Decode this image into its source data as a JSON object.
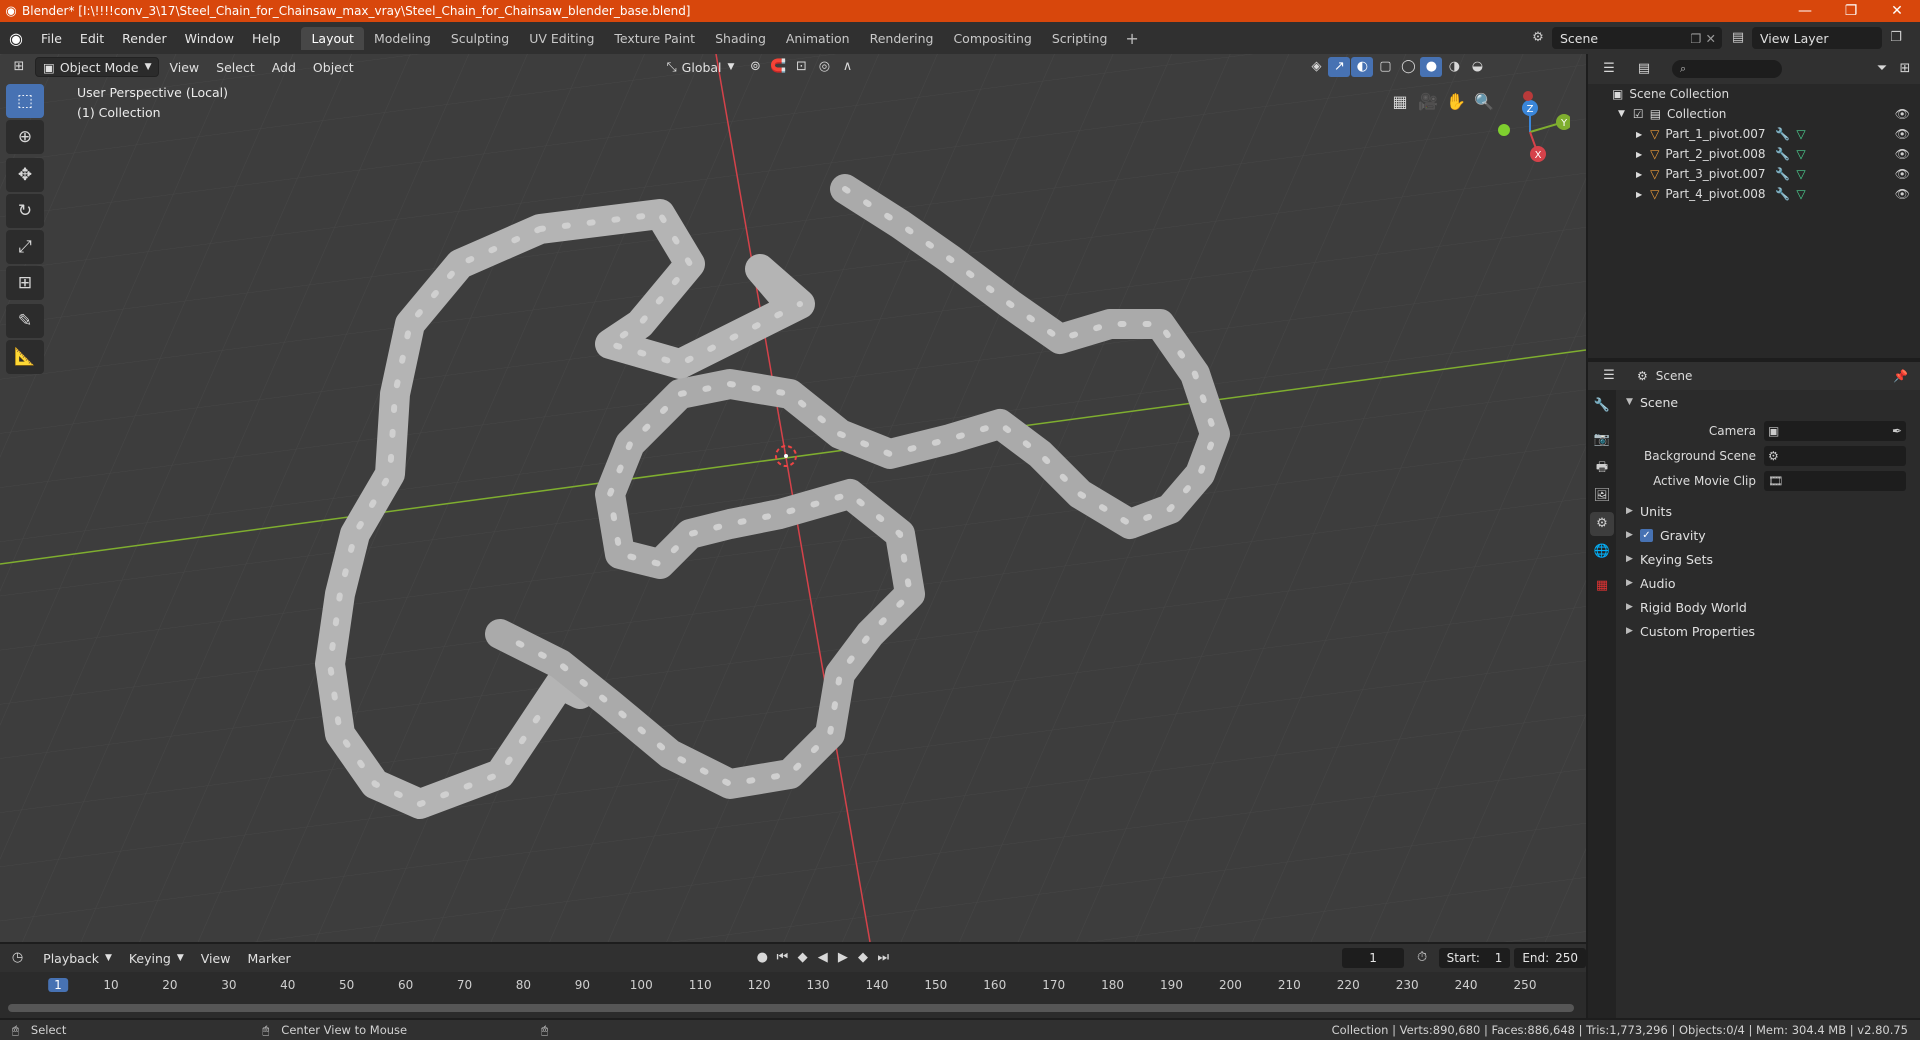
{
  "window": {
    "title": "Blender* [I:\\!!!!conv_3\\17\\Steel_Chain_for_Chainsaw_max_vray\\Steel_Chain_for_Chainsaw_blender_base.blend]",
    "minimize": "—",
    "maximize": "❐",
    "close": "✕"
  },
  "menu": {
    "items": [
      "File",
      "Edit",
      "Render",
      "Window",
      "Help"
    ],
    "workspaces": [
      "Layout",
      "Modeling",
      "Sculpting",
      "UV Editing",
      "Texture Paint",
      "Shading",
      "Animation",
      "Rendering",
      "Compositing",
      "Scripting"
    ],
    "active_workspace": "Layout",
    "scene_name": "Scene",
    "view_layer": "View Layer"
  },
  "viewport": {
    "mode": "Object Mode",
    "menus": [
      "View",
      "Select",
      "Add",
      "Object"
    ],
    "orientation": "Global",
    "overlay_line1": "User Perspective (Local)",
    "overlay_line2": "(1) Collection",
    "axis_labels": {
      "x": "X",
      "y": "Y",
      "z": "Z"
    }
  },
  "outliner": {
    "root": "Scene Collection",
    "collection": "Collection",
    "objects": [
      "Part_1_pivot.007",
      "Part_2_pivot.008",
      "Part_3_pivot.007",
      "Part_4_pivot.008"
    ]
  },
  "properties": {
    "header": "Scene",
    "section": "Scene",
    "fields": [
      {
        "label": "Camera",
        "value": ""
      },
      {
        "label": "Background Scene",
        "value": ""
      },
      {
        "label": "Active Movie Clip",
        "value": ""
      }
    ],
    "subsections": [
      "Units",
      "Gravity",
      "Keying Sets",
      "Audio",
      "Rigid Body World",
      "Custom Properties"
    ],
    "gravity_checked": true
  },
  "timeline": {
    "menus": [
      "Playback",
      "Keying",
      "View",
      "Marker"
    ],
    "current_frame": "1",
    "start_label": "Start:",
    "start": "1",
    "end_label": "End:",
    "end": "250",
    "ticks": [
      "1",
      "10",
      "20",
      "30",
      "40",
      "50",
      "60",
      "70",
      "80",
      "90",
      "100",
      "110",
      "120",
      "130",
      "140",
      "150",
      "160",
      "170",
      "180",
      "190",
      "200",
      "210",
      "220",
      "230",
      "240",
      "250"
    ]
  },
  "statusbar": {
    "left": "Select",
    "middle": "Center View to Mouse",
    "stats": "Collection | Verts:890,680 | Faces:886,648 | Tris:1,773,296 | Objects:0/4 | Mem: 304.4 MB | v2.80.75"
  },
  "colors": {
    "title_bar": "#d8470c",
    "accent_blue": "#4772b3",
    "viewport_bg": "#3d3d3d",
    "x_axis": "#d5424a",
    "y_axis": "#7fae2f",
    "z_axis": "#3a86d9"
  }
}
